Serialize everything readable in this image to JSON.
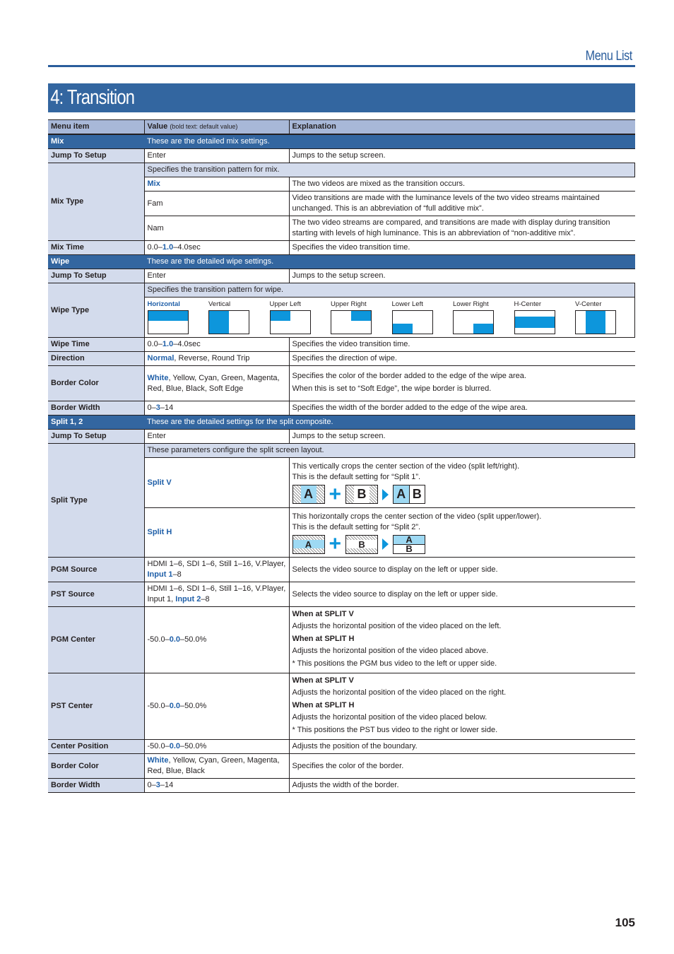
{
  "header": {
    "section": "Menu List",
    "title": "4: Transition",
    "page_number": "105"
  },
  "columns": {
    "item": "Menu item",
    "value": "Value",
    "value_note": "(bold text: default value)",
    "explanation": "Explanation"
  },
  "mix": {
    "section_label": "Mix",
    "section_desc": "These are the detailed mix settings.",
    "jump": {
      "item": "Jump To Setup",
      "value": "Enter",
      "explanation": "Jumps to the setup screen."
    },
    "mix_type": {
      "item": "Mix Type",
      "intro": "Specifies the transition pattern for mix.",
      "options": [
        {
          "value": "Mix",
          "explanation": "The two videos are mixed as the transition occurs."
        },
        {
          "value": "Fam",
          "explanation": "Video transitions are made with the luminance levels of the two video streams maintained unchanged. This is an abbreviation of “full additive mix”."
        },
        {
          "value": "Nam",
          "explanation": "The two video streams are compared, and transitions are made with display during transition starting with levels of high luminance. This is an abbreviation of “non-additive mix”."
        }
      ]
    },
    "mix_time": {
      "item": "Mix Time",
      "min": "0.0–",
      "default": "1.0",
      "max": "–4.0sec",
      "explanation": "Specifies the video transition time."
    }
  },
  "wipe": {
    "section_label": "Wipe",
    "section_desc": "These are the detailed wipe settings.",
    "jump": {
      "item": "Jump To Setup",
      "value": "Enter",
      "explanation": "Jumps to the setup screen."
    },
    "wipe_type": {
      "item": "Wipe Type",
      "intro": "Specifies the transition pattern for wipe.",
      "patterns": [
        "Horizontal",
        "Vertical",
        "Upper Left",
        "Upper Right",
        "Lower Left",
        "Lower Right",
        "H-Center",
        "V-Center"
      ]
    },
    "wipe_time": {
      "item": "Wipe Time",
      "min": "0.0–",
      "default": "1.0",
      "max": "–4.0sec",
      "explanation": "Specifies the video transition time."
    },
    "direction": {
      "item": "Direction",
      "default": "Normal",
      "rest": ", Reverse, Round Trip",
      "explanation": "Specifies the direction of wipe."
    },
    "border_color": {
      "item": "Border Color",
      "default": "White",
      "rest": ", Yellow, Cyan, Green, Magenta, Red, Blue, Black, Soft Edge",
      "explanation_1": "Specifies the color of the border added to the edge of the wipe area.",
      "explanation_2": "When this is set to “Soft Edge”, the wipe border is blurred."
    },
    "border_width": {
      "item": "Border Width",
      "min": "0–",
      "default": "3",
      "max": "–14",
      "explanation": "Specifies the width of the border added to the edge of the wipe area."
    }
  },
  "split": {
    "section_label": "Split 1, 2",
    "section_desc": "These are the detailed settings for the split composite.",
    "jump": {
      "item": "Jump To Setup",
      "value": "Enter",
      "explanation": "Jumps to the setup screen."
    },
    "split_type": {
      "item": "Split Type",
      "intro": "These parameters configure the split screen layout.",
      "options": [
        {
          "value": "Split V",
          "line1": "This vertically crops the center section of the video (split left/right).",
          "line2": "This is the default setting for “Split 1”.",
          "a": "A",
          "b": "B"
        },
        {
          "value": "Split H",
          "line1": "This horizontally crops the center section of the video (split upper/lower).",
          "line2": "This is the default setting for “Split 2”.",
          "a": "A",
          "b": "B"
        }
      ]
    },
    "pgm_source": {
      "item": "PGM Source",
      "prefix": "HDMI 1–6, SDI 1–6, Still 1–16, V.Player, ",
      "default": "Input 1",
      "suffix": "–8",
      "explanation": "Selects the video source to display on the left or upper side."
    },
    "pst_source": {
      "item": "PST Source",
      "prefix": "HDMI 1–6, SDI 1–6, Still 1–16, V.Player, Input 1, ",
      "default": "Input 2",
      "suffix": "–8",
      "explanation": "Selects the video source to display on the left or upper side."
    },
    "pgm_center": {
      "item": "PGM Center",
      "min": "-50.0–",
      "default": "0.0",
      "max": "–50.0%",
      "v_head": "When at SPLIT V",
      "v_text": "Adjusts the horizontal position of the video placed on the left.",
      "h_head": "When at SPLIT H",
      "h_text": "Adjusts the horizontal position of the video placed above.",
      "note": "* This positions the PGM bus video to the left or upper side."
    },
    "pst_center": {
      "item": "PST Center",
      "min": "-50.0–",
      "default": "0.0",
      "max": "–50.0%",
      "v_head": "When at SPLIT V",
      "v_text": "Adjusts the horizontal position of the video placed on the right.",
      "h_head": "When at SPLIT H",
      "h_text": "Adjusts the horizontal position of the video placed below.",
      "note": "* This positions the PST bus video to the right or lower side."
    },
    "center_position": {
      "item": "Center Position",
      "min": "-50.0–",
      "default": "0.0",
      "max": "–50.0%",
      "explanation": "Adjusts the position of the boundary."
    },
    "border_color": {
      "item": "Border Color",
      "default": "White",
      "rest": ", Yellow, Cyan, Green, Magenta, Red, Blue, Black",
      "explanation": "Specifies the color of the border."
    },
    "border_width": {
      "item": "Border Width",
      "min": "0–",
      "default": "3",
      "max": "–14",
      "explanation": "Adjusts the width of the border."
    }
  },
  "colors": {
    "brand_blue": "#3366a0",
    "accent_blue": "#0d96dc",
    "default_value_blue": "#1f5fa8"
  }
}
